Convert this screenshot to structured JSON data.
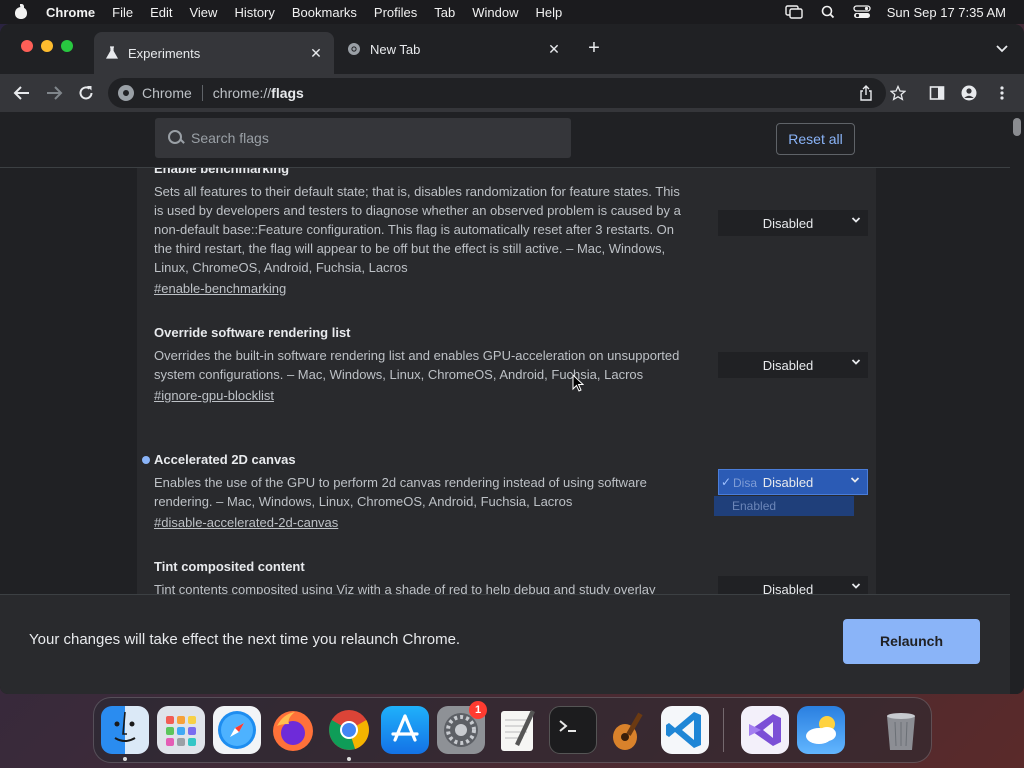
{
  "menubar": {
    "app_name": "Chrome",
    "items": [
      "File",
      "Edit",
      "View",
      "History",
      "Bookmarks",
      "Profiles",
      "Tab",
      "Window",
      "Help"
    ],
    "clock": "Sun Sep 17  7:35 AM"
  },
  "tabs": [
    {
      "title": "Experiments",
      "icon": "flask-icon",
      "active": true
    },
    {
      "title": "New Tab",
      "icon": "chrome-icon",
      "active": false
    }
  ],
  "omnibox": {
    "site_chip": "Chrome",
    "url_prefix": "chrome://",
    "url_host": "flags"
  },
  "flags_page": {
    "search_placeholder": "Search flags",
    "reset_label": "Reset all",
    "flags": [
      {
        "title": "Enable benchmarking",
        "description": "Sets all features to their default state; that is, disables randomization for feature states. This is used by developers and testers to diagnose whether an observed problem is caused by a non-default base::Feature configuration. This flag is automatically reset after 3 restarts. On the third restart, the flag will appear to be off but the effect is still active. – Mac, Windows, Linux, ChromeOS, Android, Fuchsia, Lacros",
        "link": "#enable-benchmarking",
        "value": "Disabled"
      },
      {
        "title": "Override software rendering list",
        "description": "Overrides the built-in software rendering list and enables GPU-acceleration on unsupported system configurations. – Mac, Windows, Linux, ChromeOS, Android, Fuchsia, Lacros",
        "link": "#ignore-gpu-blocklist",
        "value": "Disabled"
      },
      {
        "title": "Accelerated 2D canvas",
        "description": "Enables the use of the GPU to perform 2d canvas rendering instead of using software rendering. – Mac, Windows, Linux, ChromeOS, Android, Fuchsia, Lacros",
        "link": "#disable-accelerated-2d-canvas",
        "value": "Disabled",
        "modified": true,
        "dropdown_ghost": "Disa",
        "dropdown_option": "Enabled"
      },
      {
        "title": "Tint composited content",
        "description": "Tint contents composited using Viz with a shade of red to help debug and study overlay",
        "value": "Disabled"
      }
    ],
    "relaunch_message": "Your changes will take effect the next time you relaunch Chrome.",
    "relaunch_label": "Relaunch"
  },
  "dock": {
    "apps": [
      "finder-icon",
      "launchpad-icon",
      "safari-icon",
      "firefox-icon",
      "chrome-icon",
      "app-store-icon",
      "system-settings-icon",
      "textedit-icon",
      "terminal-icon",
      "garageband-icon",
      "vscode-icon",
      "visual-studio-icon",
      "weather-icon",
      "trash-icon"
    ],
    "settings_badge": "1"
  },
  "colors": {
    "accent": "#8ab4f8",
    "page_bg": "#202124",
    "panel_bg": "#292a2d"
  }
}
